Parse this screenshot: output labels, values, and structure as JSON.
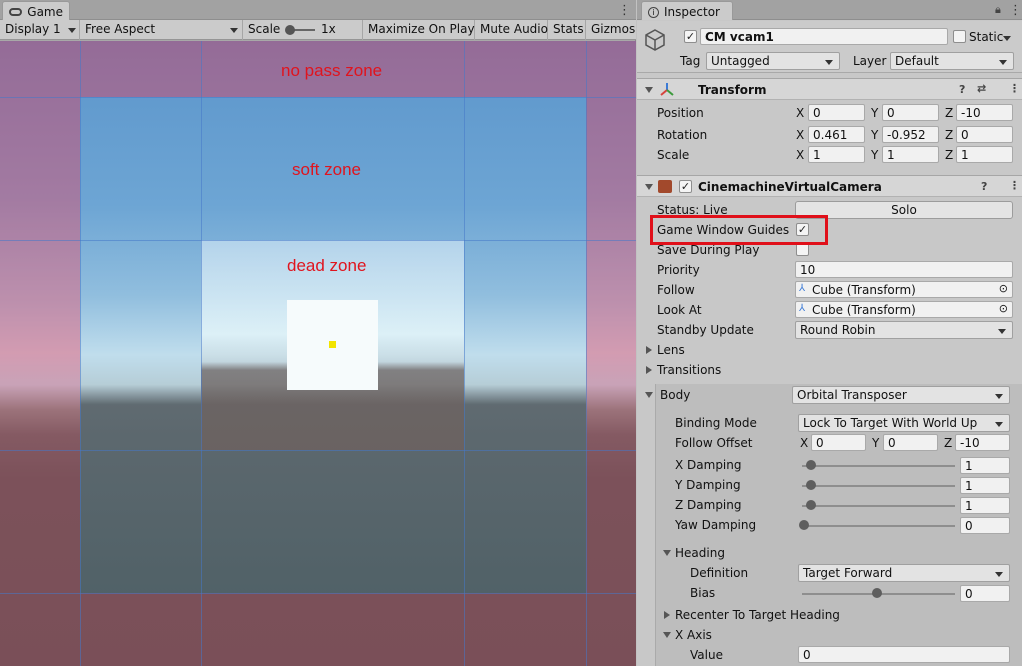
{
  "game": {
    "tab_label": "Game",
    "toolbar": {
      "display": "Display 1",
      "aspect": "Free Aspect",
      "scale_label": "Scale",
      "scale_value": "1x",
      "maximize": "Maximize On Play",
      "mute": "Mute Audio",
      "stats": "Stats",
      "gizmos": "Gizmos"
    },
    "zones": {
      "no_pass": "no pass zone",
      "soft": "soft zone",
      "dead": "dead zone"
    }
  },
  "inspector": {
    "tab_label": "Inspector",
    "object_name": "CM vcam1",
    "static_label": "Static",
    "tag_label": "Tag",
    "tag_value": "Untagged",
    "layer_label": "Layer",
    "layer_value": "Default",
    "transform": {
      "title": "Transform",
      "position_label": "Position",
      "rotation_label": "Rotation",
      "scale_label": "Scale",
      "position": {
        "x": "0",
        "y": "0",
        "z": "-10"
      },
      "rotation": {
        "x": "0.461",
        "y": "-0.952",
        "z": "0"
      },
      "scale": {
        "x": "1",
        "y": "1",
        "z": "1"
      }
    },
    "vcam": {
      "title": "CinemachineVirtualCamera",
      "status": "Status: Live",
      "solo": "Solo",
      "game_window_guides": "Game Window Guides",
      "save_during_play": "Save During Play",
      "priority_label": "Priority",
      "priority": "10",
      "follow_label": "Follow",
      "follow": "Cube (Transform)",
      "lookat_label": "Look At",
      "lookat": "Cube (Transform)",
      "standby_label": "Standby Update",
      "standby": "Round Robin",
      "lens": "Lens",
      "transitions": "Transitions",
      "body_label": "Body",
      "body": "Orbital Transposer"
    },
    "body": {
      "binding_label": "Binding Mode",
      "binding": "Lock To Target With World Up",
      "offset_label": "Follow Offset",
      "offset": {
        "x": "0",
        "y": "0",
        "z": "-10"
      },
      "xdamp_label": "X Damping",
      "xdamp": "1",
      "ydamp_label": "Y Damping",
      "ydamp": "1",
      "zdamp_label": "Z Damping",
      "zdamp": "1",
      "yawdamp_label": "Yaw Damping",
      "yawdamp": "0",
      "heading_label": "Heading",
      "definition_label": "Definition",
      "definition": "Target Forward",
      "bias_label": "Bias",
      "bias": "0",
      "recenter_label": "Recenter To Target Heading",
      "xaxis_label": "X Axis",
      "value_label": "Value",
      "value": "0"
    },
    "axis_letters": {
      "x": "X",
      "y": "Y",
      "z": "Z"
    }
  }
}
